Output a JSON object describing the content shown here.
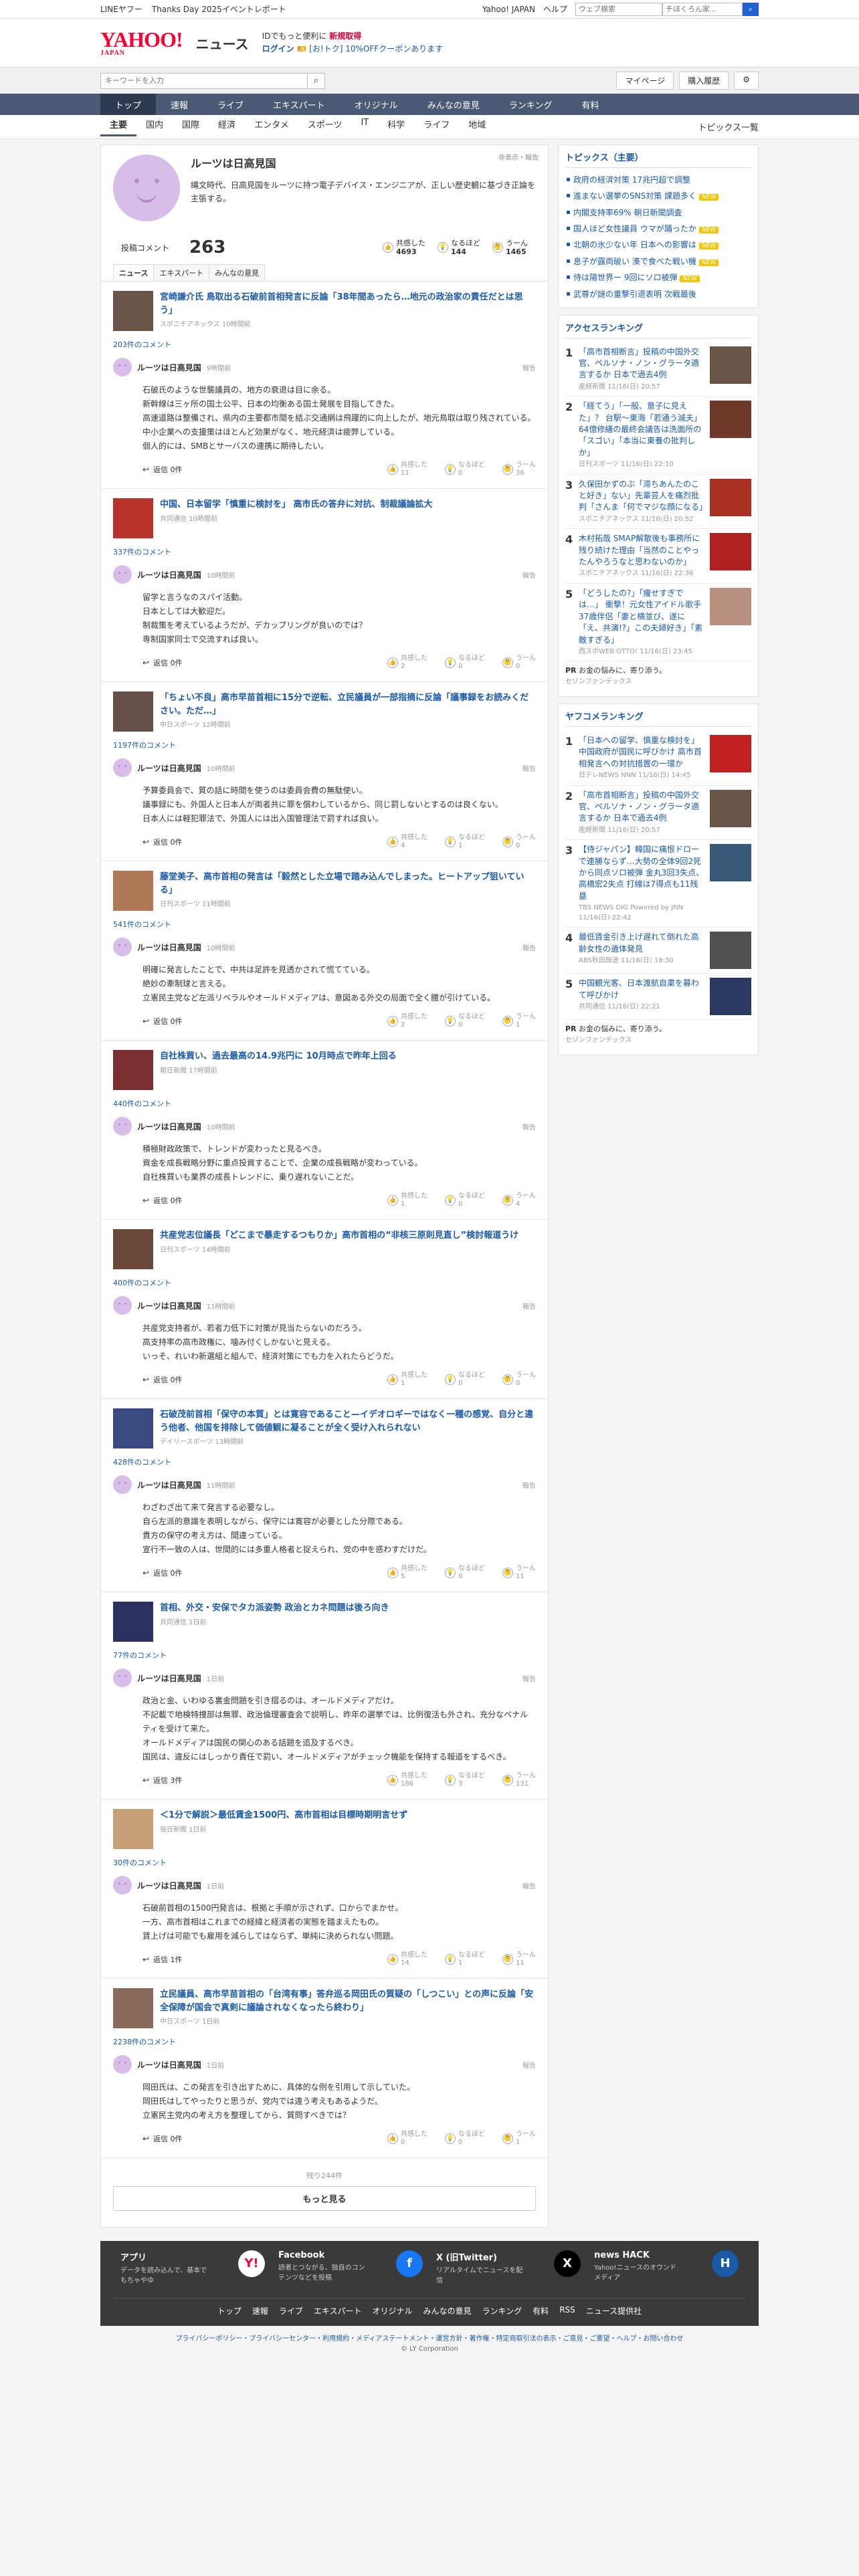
{
  "topbar": {
    "links": [
      "LINEヤフー",
      "Thanks Day 2025イベントレポート"
    ],
    "right": [
      "Yahoo! JAPAN",
      "ヘルプ"
    ],
    "search_placeholder": "ウェブ検索",
    "search_ext": "チほくろん家..."
  },
  "header": {
    "logo": "YAHOO!",
    "logo_sub": "JAPAN",
    "section": "ニュース",
    "promo_line1_a": "IDでもっと便利に",
    "promo_line1_b": "新規取得",
    "promo_line2_a": "ログイン",
    "promo_line2_b": "[お!トク] 10%OFFクーポンあります"
  },
  "searchbar": {
    "placeholder": "キーワードを入力",
    "mypage": "マイページ",
    "purchases": "購入履歴"
  },
  "gnav": [
    "トップ",
    "速報",
    "ライブ",
    "エキスパート",
    "オリジナル",
    "みんなの意見",
    "ランキング",
    "有料"
  ],
  "subnav": {
    "cats": [
      "主要",
      "国内",
      "国際",
      "経済",
      "エンタメ",
      "スポーツ",
      "IT",
      "科学",
      "ライフ",
      "地域"
    ],
    "right": "トピックス一覧"
  },
  "profile": {
    "name": "ルーツは日高見国",
    "desc": "縄文時代、日高見国をルーツに持つ電子デバイス・エンジニアが、正しい歴史観に基づき正論を主張する。",
    "report": "非表示・報告",
    "comment_label": "投稿コメント",
    "comment_count": "263",
    "kyokan_label": "共感した",
    "kyokan": "4693",
    "naruhodo_label": "なるほど",
    "naruhodo": "144",
    "uun_label": "うーん",
    "uun": "1465"
  },
  "tabs": [
    "ニュース",
    "エキスパート",
    "みんなの意見"
  ],
  "labels": {
    "report": "報告",
    "reply": "返信",
    "kyokan": "共感した",
    "naruhodo": "なるほど",
    "uun": "うーん"
  },
  "cards": [
    {
      "title": "宮崎謙介氏 鳥取出る石破前首相発言に反論「38年間あったら…地元の政治家の責任だとは思う」",
      "source": "スポニチアネックス",
      "time": "10時間前",
      "ccount": "203件のコメント",
      "ctime": "9時間前",
      "body": "石破氏のような世襲議員の、地方の衰退は目に余る。\n新幹線は三ヶ所の国土公平、日本の均衡ある国土発展を目指してきた。\n高速道路は整備され、県内の主要都市間を結ぶ交通網は飛躍的に向上したが、地元鳥取は取り残されている。\n中小企業への支援策はほとんど効果がなく、地元経済は疲弊している。\n個人的には、SMBとサーバスの連携に期待したい。",
      "reply": "返信 0件",
      "k": "11",
      "n": "0",
      "u": "36",
      "thumb": "#6a5448"
    },
    {
      "title": "中国、日本留学「慎重に検討を」 高市氏の答弁に対抗、制裁議論拡大",
      "source": "共同通信",
      "time": "10時間前",
      "ccount": "337件のコメント",
      "ctime": "10時間前",
      "body": "留学と言うなのスパイ活動。\n日本としては大歓迎だ。\n制裁策を考えているようだが、デカップリングが良いのでは？\n専制国家同士で交流すれば良い。",
      "reply": "返信 0件",
      "k": "2",
      "n": "0",
      "u": "0",
      "thumb": "#b8342a"
    },
    {
      "title": "「ちょい不良」高市早苗首相に15分で逆転、立民議員が一部指摘に反論「議事録をお読みください。ただ…」",
      "source": "中日スポーツ",
      "time": "12時間前",
      "ccount": "1197件のコメント",
      "ctime": "10時間前",
      "body": "予算委員会で、質の話に時間を使うのは委員会費の無駄使い。\n議事録にも、外国人と日本人が両者共に罪を償わしているから、同じ罰しないとするのは良くない。\n日本人には軽犯罪法で、外国人には出入国管理法で罰すれば良い。",
      "reply": "返信 0件",
      "k": "4",
      "n": "1",
      "u": "0",
      "thumb": "#665048"
    },
    {
      "title": "藤堂美子、高市首相の発言は「毅然とした立場で踏み込んでしまった。ヒートアップ狙いている」",
      "source": "日刊スポーツ",
      "time": "11時間前",
      "ccount": "541件のコメント",
      "ctime": "10時間前",
      "body": "明確に発言したことで、中共は足許を見透かされて慌てている。\n絶妙の牽制球と言える。\n立憲民主党など左派リベラルやオールドメディアは、意図ある外交の局面で全く腰が引けている。",
      "reply": "返信 0件",
      "k": "2",
      "n": "0",
      "u": "1",
      "thumb": "#b07a58"
    },
    {
      "title": "自社株買い、過去最高の14.9兆円に 10月時点で昨年上回る",
      "source": "朝日新聞",
      "time": "17時間前",
      "ccount": "440件のコメント",
      "ctime": "10時間前",
      "body": "積極財政政策で、トレンドが変わったと見るべき。\n資金を成長戦略分野に重点投資することで、企業の成長戦略が変わっている。\n自社株買いも業界の成長トレンドに、乗り遅れないことだ。",
      "reply": "返信 0件",
      "k": "1",
      "n": "0",
      "u": "4",
      "thumb": "#7a3030"
    },
    {
      "title": "共産党志位議長「どこまで暴走するつもりか」高市首相の“非核三原則見直し”検討報道うけ",
      "source": "日刊スポーツ",
      "time": "14時間前",
      "ccount": "400件のコメント",
      "ctime": "11時間前",
      "body": "共産党支持者が、若者力低下に対策が見当たらないのだろう。\n高支持率の高市政権に、噛み付くしかないと見える。\nいっそ、れいわ新選組と組んで、経済対策にでも力を入れたらどうだ。",
      "reply": "返信 0件",
      "k": "1",
      "n": "0",
      "u": "0",
      "thumb": "#6a4838"
    },
    {
      "title": "石破茂前首相「保守の本質」とは寛容であること—イデオロギーではなく一種の感覚、自分と違う他者、他国を排除して価値観に凝ることが全く受け入れられない",
      "source": "デイリースポーツ",
      "time": "13時間前",
      "ccount": "428件のコメント",
      "ctime": "11時間前",
      "body": "わざわざ出て来て発言する必要なし。\n自ら左派的意識を表明しながら、保守には寛容が必要とした分際である。\n貴方の保守の考え方は、間違っている。\n宣行不一致の人は、世間的には多重人格者と捉えられ、党の中を惑わすだけだ。",
      "reply": "返信 0件",
      "k": "5",
      "n": "0",
      "u": "11",
      "thumb": "#384a80"
    },
    {
      "title": "首相、外交・安保でタカ派姿勢 政治とカネ問題は後ろ向き",
      "source": "共同通信",
      "time": "1日前",
      "ccount": "77件のコメント",
      "ctime": "1日前",
      "body": "政治と金、いわゆる裏金問題を引き摺るのは、オールドメディアだけ。\n不記載で地検特捜部は無罪、政治倫理審査会で説明し、昨年の選挙では、比例復活も外され、充分なペナルティを受けて来た。\nオールドメディアは国民の関心のある話題を追及するべき。\n国民は、違反にはしっかり責任で罰い、オールドメディアがチェック機能を保持する報道をするべき。",
      "reply": "返信 3件",
      "k": "186",
      "n": "3",
      "u": "131",
      "thumb": "#2a3060"
    },
    {
      "title": "＜1分で解説＞最低賃金1500円、高市首相は目標時期明言せず",
      "source": "毎日新聞",
      "time": "1日前",
      "ccount": "30件のコメント",
      "ctime": "1日前",
      "body": "石破前首相の1500円発言は、根拠と手順が示されず、口からでまかせ。\n一方、高市首相はこれまでの経緯と経済者の実態を踏まえたもの。\n賃上げは可能でも雇用を減らしてはならず、単純に決められない問題。",
      "reply": "返信 1件",
      "k": "14",
      "n": "1",
      "u": "11",
      "thumb": "#c8a078"
    },
    {
      "title": "立民議員、高市早苗首相の「台湾有事」答弁巡る岡田氏の質疑の「しつこい」との声に反論「安全保障が国会で真剣に議論されなくなったら終わり」",
      "source": "中日スポーツ",
      "time": "1日前",
      "ccount": "2238件のコメント",
      "ctime": "1日前",
      "body": "岡田氏は、この発言を引き出すために、具体的な例を引用して示していた。\n岡田氏はしてやったりと思うが、党内では違う考えもあるようだ。\n立憲民主党内の考え方を整理してから、質問すべきでは？",
      "reply": "返信 0件",
      "k": "0",
      "n": "0",
      "u": "1",
      "thumb": "#8a6a5a"
    }
  ],
  "more": {
    "remaining": "残り244件",
    "button": "もっと見る"
  },
  "side": {
    "topics_title": "トピックス（主要）",
    "topics": [
      {
        "t": "政府の経済対策 17兆円超で調整",
        "new": false
      },
      {
        "t": "進まない選挙のSNS対策 課題多く",
        "new": true
      },
      {
        "t": "内閣支持率69% 朝日新聞調査",
        "new": false
      },
      {
        "t": "国人ほど女性議員 ウマが踊ったか",
        "new": true
      },
      {
        "t": "北朝の氷少ない年 日本への影響は",
        "new": true
      },
      {
        "t": "息子が露両破い 湊で食べた戦い機",
        "new": true
      },
      {
        "t": "侍は陽世界ー 9回にソロ被弾",
        "new": true
      },
      {
        "t": "武尊が謎の重撃引退表明 次戦最後",
        "new": false
      }
    ],
    "access_title": "アクセスランキング",
    "access": [
      {
        "t": "「高市首相断言」投稿の中国外交官、ペルソナ・ノン・グラータ適言するか 日本で過去4例",
        "s": "産経新聞 11/16(日) 20:57",
        "c": "#6a5448"
      },
      {
        "t": "「経てう」「一般、意子に見えた」？ 台駅～東海「若通う滅夫」64億修繕の最終会議告は洗面所の「スゴい」「本当に東養の批判しか」",
        "s": "日刊スポーツ 11/16(日) 22:10",
        "c": "#703828"
      },
      {
        "t": "久保田かずのぶ「滞ちあんたのこと好き」ない」先輩芸人を痛烈批判「さんま「何でマジな顔になる」",
        "s": "スポニチアネックス 11/16(日) 20:52",
        "c": "#a83020"
      },
      {
        "t": "木村拓哉 SMAP解散後も事務所に残り続けた理由「当然のことやったんやろうなと思わないのか」",
        "s": "スポニチアネックス 11/16(日) 22:36",
        "c": "#b02020"
      },
      {
        "t": "「どうしたの?」「痩せすぎでは…」 衝撃！元女性アイドル歌手 37歳伴侶「妻と横並び、遂に「え、共演!?」この夫婦好き」「素敵すぎる」",
        "s": "西スポWEB OTTO! 11/16(日) 23:45",
        "c": "#b89080"
      }
    ],
    "pr1_title": "お金の悩みに、寄り添う。",
    "pr1_src": "セゾンファンデックス",
    "yahoo_title": "ヤフコメランキング",
    "yahoo": [
      {
        "t": "「日本への留学、慎重な検討を」中国政府が国民に呼びかけ 高市首相発言への対抗措置の一環か",
        "s": "日テレNEWS NNN 11/16(日) 14:45",
        "c": "#c02020"
      },
      {
        "t": "「高市首相断言」投稿の中国外交官、ペルソナ・ノン・グラータ適言するか 日本で過去4例",
        "s": "産経新聞 11/16(日) 20:57",
        "c": "#6a5448"
      },
      {
        "t": "【侍ジャパン】韓国に痛恨ドローで連勝ならず…大勢の全体9回2死から同点ソロ被弾 金丸3回3失点、高橋宏2失点 打線は7得点も11残塁",
        "s": "TBS NEWS DIG Powered by JNN 11/16(日) 22:42",
        "c": "#385878"
      },
      {
        "t": "最低賃金引き上げ遅れて倒れた高齢女性の遺体発見",
        "s": "ABS秋田放送 11/16(日) 18:30",
        "c": "#505050"
      },
      {
        "t": "中国観光客、日本渡航自粛を募わて呼びかけ",
        "s": "共同通信 11/16(日) 22:21",
        "c": "#2a3a60"
      }
    ],
    "pr2_title": "お金の悩みに、寄り添う。",
    "pr2_src": "セゾンファンデックス"
  },
  "footer": {
    "apps": [
      {
        "t": "アプリ",
        "d": "データを読み込んで、基本でもちゃやゆ",
        "ico": "Y!"
      },
      {
        "t": "Facebook",
        "d": "読者とつながる、独自のコンテンツなどを投稿",
        "ico": "f"
      },
      {
        "t": "X (旧Twitter)",
        "d": "リアルタイムでニュースを配信",
        "ico": "X"
      },
      {
        "t": "news HACK",
        "d": "Yahoo!ニュースのオウンドメディア",
        "ico": "H"
      }
    ],
    "nav": [
      "トップ",
      "速報",
      "ライブ",
      "エキスパート",
      "オリジナル",
      "みんなの意見",
      "ランキング",
      "有料",
      "RSS",
      "ニュース提供社"
    ],
    "links": "プライバシーポリシー・プライバシーセンター・利用規約・メディアステートメント・運営方針・著作権・特定商取引法の表示・ご意見・ご要望・ヘルプ・お問い合わせ",
    "copy": "© LY Corporation"
  },
  "colors": {
    "brand": "#ff0033",
    "nav": "#4a5a75",
    "link": "#1a5aa7"
  }
}
